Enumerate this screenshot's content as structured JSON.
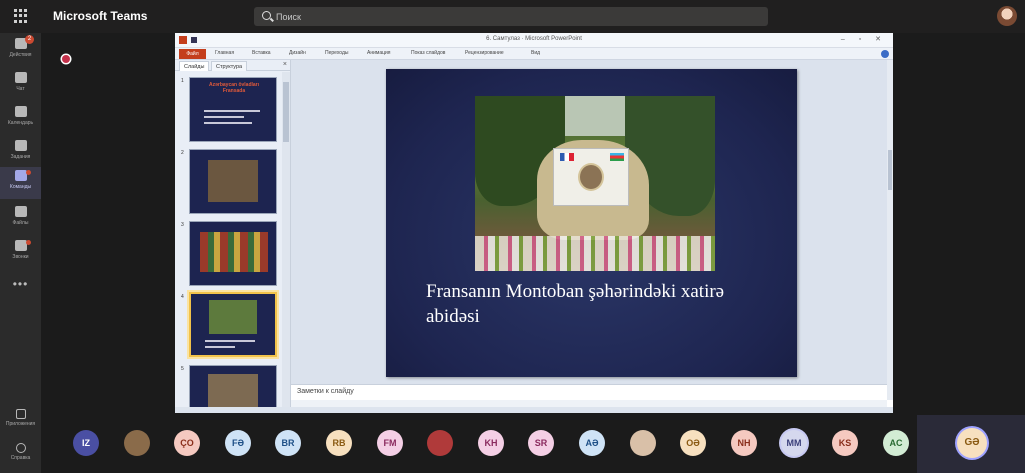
{
  "topbar": {
    "app_title": "Microsoft Teams",
    "search_placeholder": "Поиск",
    "avatar_icon": "user-avatar"
  },
  "rail": {
    "items": [
      {
        "label": "Действия",
        "icon": "bell-icon",
        "badge": "2"
      },
      {
        "label": "Чат",
        "icon": "chat-icon"
      },
      {
        "label": "Календарь",
        "icon": "calendar-icon"
      },
      {
        "label": "Задания",
        "icon": "assignments-icon"
      },
      {
        "label": "Команды",
        "icon": "teams-icon",
        "active": true
      },
      {
        "label": "Файлы",
        "icon": "files-icon"
      },
      {
        "label": "Звонки",
        "icon": "calls-icon"
      }
    ],
    "more": "•••",
    "bottom_items": [
      {
        "label": "Приложения",
        "icon": "apps-icon"
      },
      {
        "label": "Справка",
        "icon": "help-icon"
      }
    ]
  },
  "powerpoint": {
    "window_title": "6. Самтулаз · Microsoft PowerPoint",
    "window_buttons": "– ▫ ✕",
    "ribbon_tabs": [
      "Файл",
      "Главная",
      "Вставка",
      "Дизайн",
      "Переходы",
      "Анимация",
      "Показ слайдов",
      "Рецензирование",
      "Вид"
    ],
    "panel_tabs": [
      "Слайды",
      "Структура"
    ],
    "panel_close": "×",
    "thumbnails": [
      {
        "num": "1",
        "title": "Azərbaycan övladları Fransada"
      },
      {
        "num": "2"
      },
      {
        "num": "3"
      },
      {
        "num": "4",
        "active": true
      },
      {
        "num": "5"
      }
    ],
    "slide_caption": "Fransanın Montoban şəhərindəki xatirə abidəsi",
    "notes_placeholder": "Заметки к слайду"
  },
  "participants": [
    {
      "initials": "IZ",
      "bg": "#4a4fa3",
      "fg": "#ffffff"
    },
    {
      "initials": "",
      "bg": "#8a6b4a",
      "fg": "#ffffff",
      "photo": true
    },
    {
      "initials": "ÇO",
      "bg": "#f5c9c0",
      "fg": "#8a2e1a"
    },
    {
      "initials": "FƏ",
      "bg": "#cfe3f6",
      "fg": "#1d4f86"
    },
    {
      "initials": "BR",
      "bg": "#cfe3f6",
      "fg": "#1d4f86"
    },
    {
      "initials": "RB",
      "bg": "#f7e0bf",
      "fg": "#8a5a12"
    },
    {
      "initials": "FM",
      "bg": "#f4cfe5",
      "fg": "#8a2a5e"
    },
    {
      "initials": "",
      "bg": "#b03a3a",
      "fg": "#ffffff",
      "photo": true
    },
    {
      "initials": "KH",
      "bg": "#f4cfe5",
      "fg": "#8a2a5e"
    },
    {
      "initials": "SR",
      "bg": "#f4cfe5",
      "fg": "#8a2a5e"
    },
    {
      "initials": "AƏ",
      "bg": "#cfe3f6",
      "fg": "#1d4f86"
    },
    {
      "initials": "",
      "bg": "#d9c0a8",
      "fg": "#ffffff",
      "photo": true
    },
    {
      "initials": "OƏ",
      "bg": "#f7e0bf",
      "fg": "#8a5a12"
    },
    {
      "initials": "NH",
      "bg": "#f5c9c0",
      "fg": "#8a2e1a"
    },
    {
      "initials": "MM",
      "bg": "#d5d8ee",
      "fg": "#3b3f7a"
    },
    {
      "initials": "KS",
      "bg": "#f5c9c0",
      "fg": "#8a2e1a"
    },
    {
      "initials": "AC",
      "bg": "#d2ecd4",
      "fg": "#2a6b33"
    }
  ],
  "self_view": {
    "initials": "GƏ",
    "bg": "#f7e0bf",
    "fg": "#8a5a12"
  }
}
